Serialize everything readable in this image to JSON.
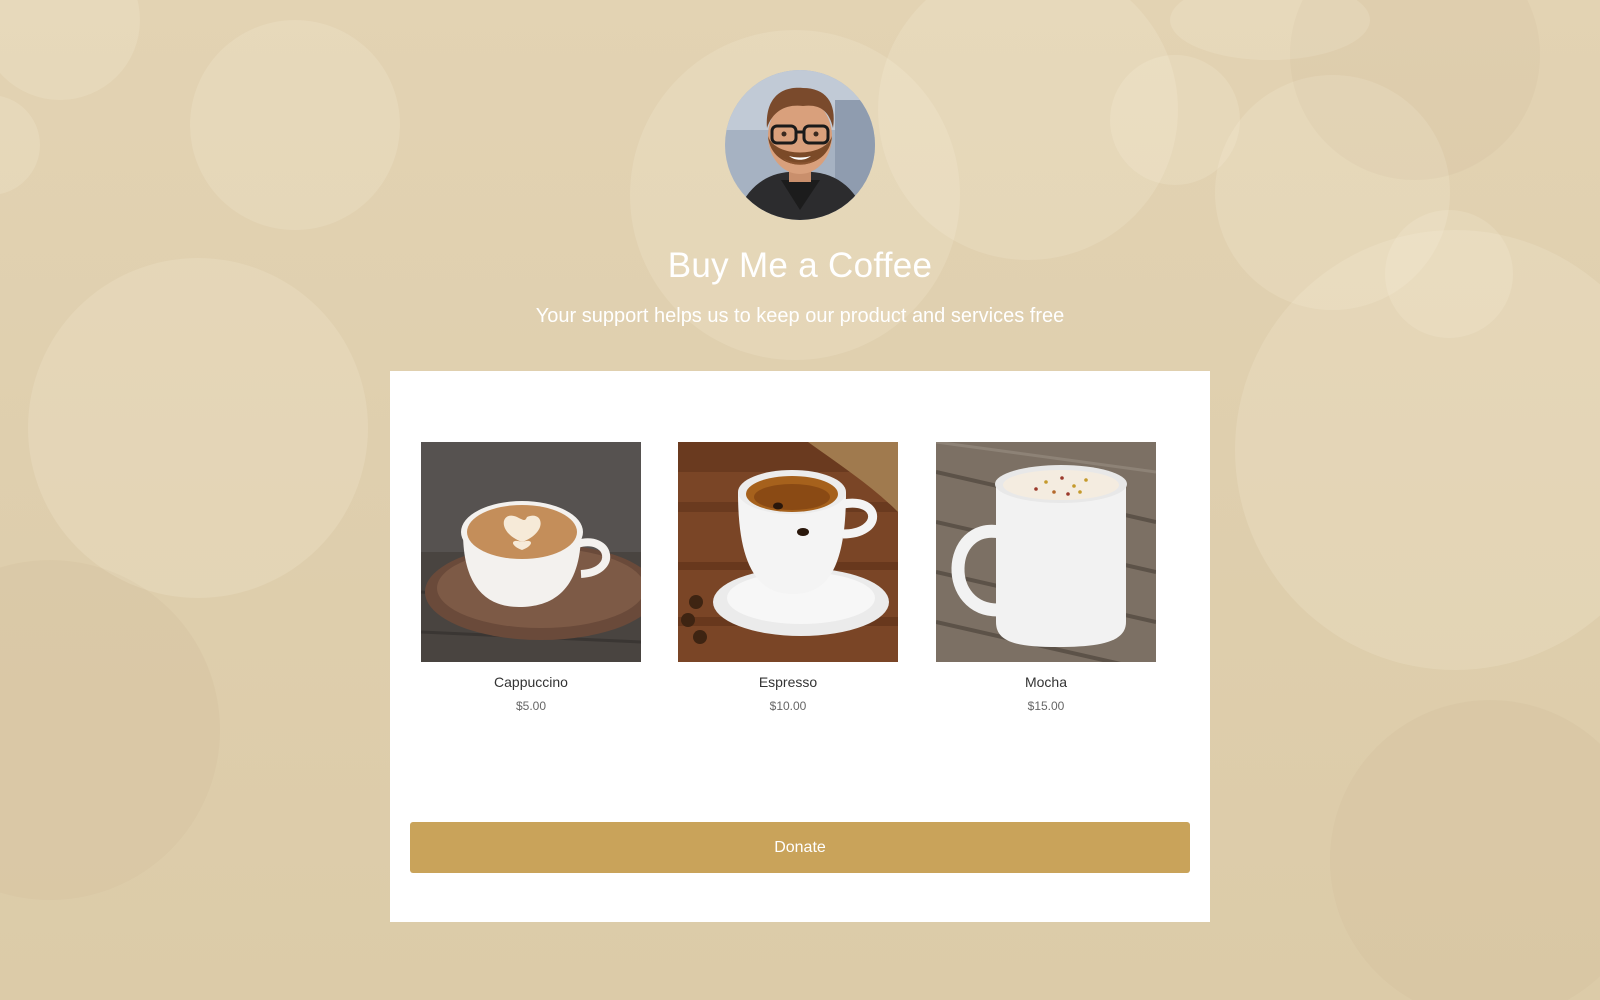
{
  "page": {
    "title": "Buy Me a Coffee",
    "subtitle": "Your support helps us to keep our product and services free"
  },
  "products": [
    {
      "name": "Cappuccino",
      "price": "$5.00",
      "image": "cappuccino-photo"
    },
    {
      "name": "Espresso",
      "price": "$10.00",
      "image": "espresso-photo"
    },
    {
      "name": "Mocha",
      "price": "$15.00",
      "image": "mocha-photo"
    }
  ],
  "donate": {
    "label": "Donate"
  },
  "colors": {
    "background": "#e3d3b3",
    "card": "#ffffff",
    "accent": "#c9a35a",
    "text_primary": "#333333",
    "text_secondary": "#666666"
  }
}
